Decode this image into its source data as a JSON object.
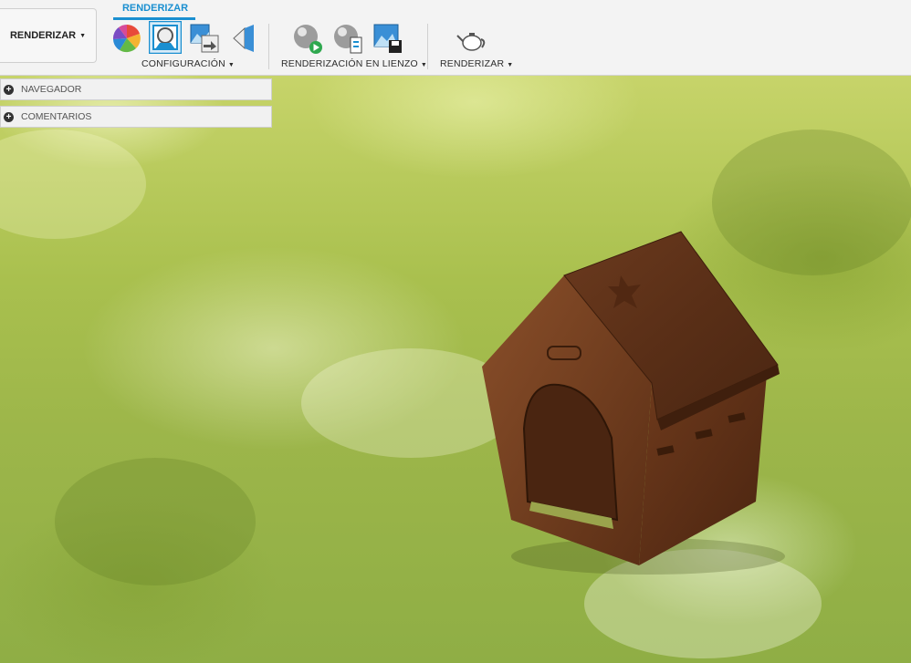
{
  "workspace": {
    "label": "RENDERIZAR"
  },
  "tab": {
    "label": "RENDERIZAR"
  },
  "groups": {
    "configuracion": "CONFIGURACIÓN",
    "renderizacion_lienzo": "RENDERIZACIÓN EN LIENZO",
    "renderizar": "RENDERIZAR"
  },
  "panels": {
    "navegador": "NAVEGADOR",
    "comentarios": "COMENTARIOS"
  },
  "icons": [
    "appearance-icon",
    "scene-settings-icon",
    "texture-map-icon",
    "decal-icon",
    "in-canvas-render-icon",
    "in-canvas-render-settings-icon",
    "capture-image-icon",
    "render-teapot-icon"
  ],
  "colors": {
    "accent": "#1a8fd0",
    "toolbar_bg": "#f3f3f3"
  }
}
